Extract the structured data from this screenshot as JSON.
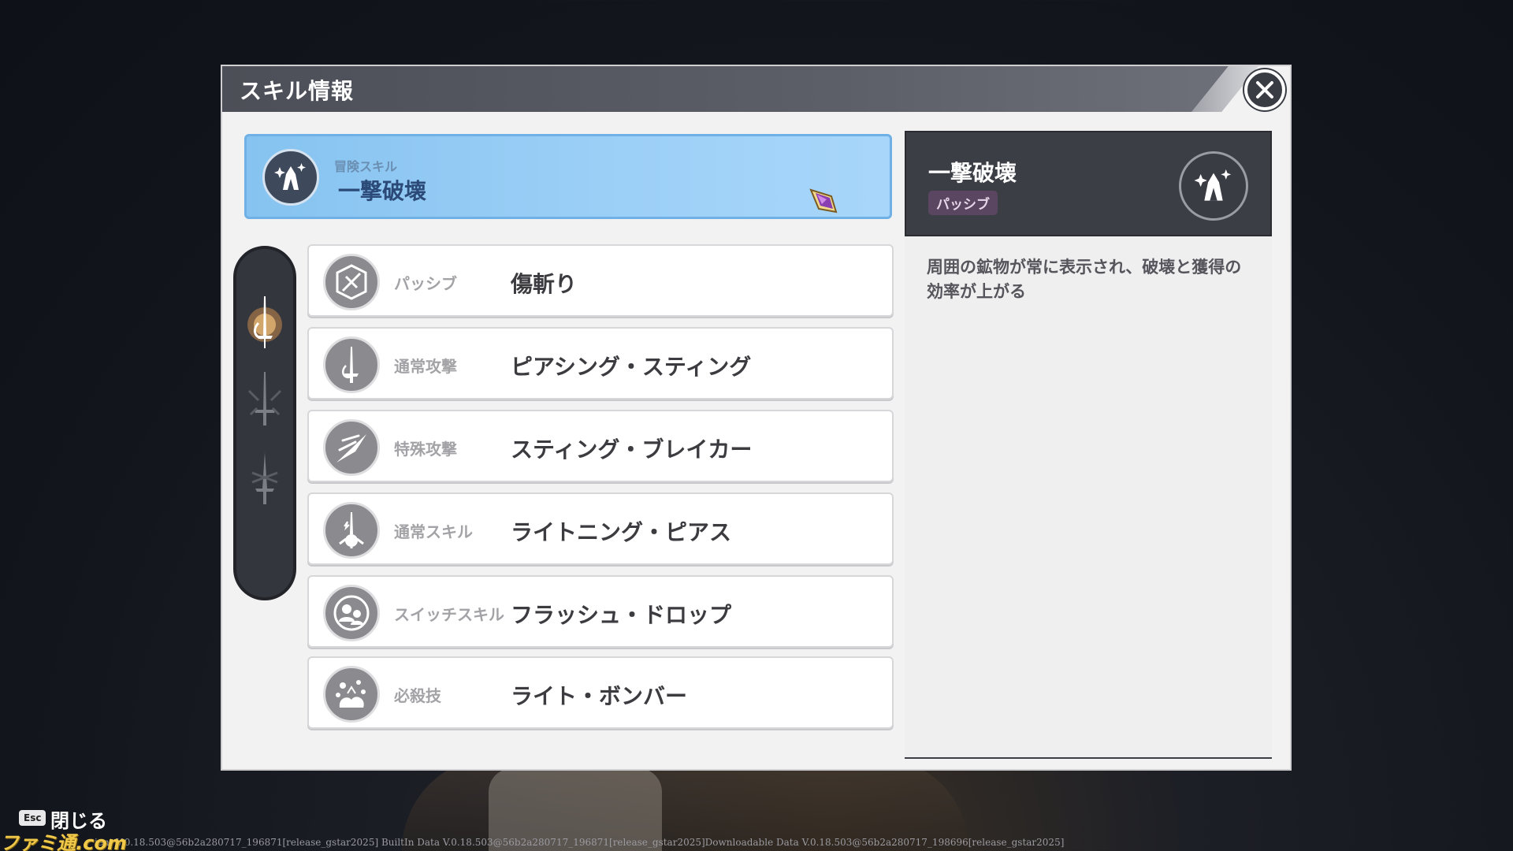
{
  "dialog": {
    "title": "スキル情報"
  },
  "selected_skill": {
    "category": "冒険スキル",
    "name": "一撃破壊",
    "icon": "crystal-icon"
  },
  "side_tabs": [
    {
      "icon": "sword-emblem-icon",
      "active": true
    },
    {
      "icon": "sword-icon",
      "active": false
    },
    {
      "icon": "dagger-icon",
      "active": false
    }
  ],
  "skills": [
    {
      "type": "パッシブ",
      "name": "傷斬り",
      "icon": "shield-slash-icon"
    },
    {
      "type": "通常攻撃",
      "name": "ピアシング・スティング",
      "icon": "rapier-icon"
    },
    {
      "type": "特殊攻撃",
      "name": "スティング・ブレイカー",
      "icon": "thrust-icon"
    },
    {
      "type": "通常スキル",
      "name": "ライトニング・ピアス",
      "icon": "lightning-rapier-icon"
    },
    {
      "type": "スイッチスキル",
      "name": "フラッシュ・ドロップ",
      "icon": "swap-people-icon"
    },
    {
      "type": "必殺技",
      "name": "ライト・ボンバー",
      "icon": "explosion-icon"
    }
  ],
  "detail": {
    "title": "一撃破壊",
    "badge": "パッシブ",
    "description": "周囲の鉱物が常に表示され、破壊と獲得の効率が上がる",
    "icon": "crystal-icon"
  },
  "footer": {
    "esc_key": "Esc",
    "close_label": "閉じる",
    "version": "ient V.0.18.503@56b2a280717_196871[release_gstar2025] BuiltIn Data V.0.18.503@56b2a280717_196871[release_gstar2025]Downloadable Data V.0.18.503@56b2a280717_198696[release_gstar2025]",
    "watermark": "ファミ通.com"
  },
  "colors": {
    "accent_blue": "#9dd0f7",
    "panel_dark": "#3c3e46",
    "badge_purple": "#5a4660"
  }
}
